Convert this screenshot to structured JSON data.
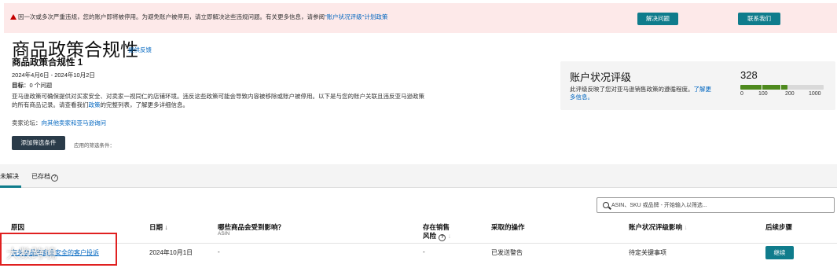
{
  "alert": {
    "text": "因一次或多次严重违规，您的账户即将被停用。为避免账户被停用，请立即解决这些违规问题。有关更多信息，请参阅",
    "link": "\"账户状况评级\"计划政策",
    "resolve_label": "解决问题",
    "contact_label": "联系我们"
  },
  "page": {
    "title": "商品政策合规性",
    "feedback": "提供反馈",
    "subtitle": "商品政策合规性 1",
    "date_range": "2024年4月6日 - 2024年10月2日",
    "goal_label": "目标",
    "goal_value": "：0 个问题",
    "description_1": "亚马逊政策可确保提供对买家安全、对卖家一视同仁的店铺环境。违反这些政策可能会导致内容被移除或账户被停用。以下是与您的账户关联且违反亚马逊政策的所有商品记录。请查看我们",
    "description_link": "政策",
    "description_2": "的完整列表，了解更多详细信息。",
    "forum_label": "卖家论坛：",
    "forum_link": "向其他卖家和亚马逊询问",
    "filter_button": "添加筛选条件",
    "applied_filters": "应用的筛选条件："
  },
  "health": {
    "title": "账户状况评级",
    "description": "此评级反映了您对亚马逊销售政策的遵循程度。",
    "learn_more": "了解更多信息。",
    "score": "328",
    "score_value": 328,
    "scale": [
      "0",
      "100",
      "200",
      "1000"
    ]
  },
  "tabs": [
    {
      "label": "未解决"
    },
    {
      "label": "已存档"
    }
  ],
  "help_icon_glyph": "?",
  "search": {
    "placeholder": "ASIN、SKU 或品牌 - 开始输入以筛选..."
  },
  "table": {
    "headers": {
      "reason": "原因",
      "date": "日期",
      "date_sort": "↓",
      "affected": "哪些商品会受到影响？",
      "affected_sub": "ASIN",
      "risk_line1": "存在销售",
      "risk_line2": "风险",
      "risk_sort": "↓",
      "action": "采取的操作",
      "impact": "账户状况评级影响",
      "impact_sort": "↓",
      "next": "后续步骤"
    },
    "rows": [
      {
        "reason": "有关食品和商品安全的客户投诉",
        "date": "2024年10月1日",
        "affected": "-",
        "risk": "-",
        "action": "已发送警告",
        "impact": "待定关键事项",
        "next": "继续"
      }
    ]
  },
  "watermark": "大数跨境",
  "colors": {
    "alert_bg": "#fde9e9",
    "teal": "#0f7c8c",
    "link": "#0066c0",
    "dark_button": "#2a3b49",
    "health_bar": "#4e8a1e",
    "highlight": "#e02020"
  }
}
